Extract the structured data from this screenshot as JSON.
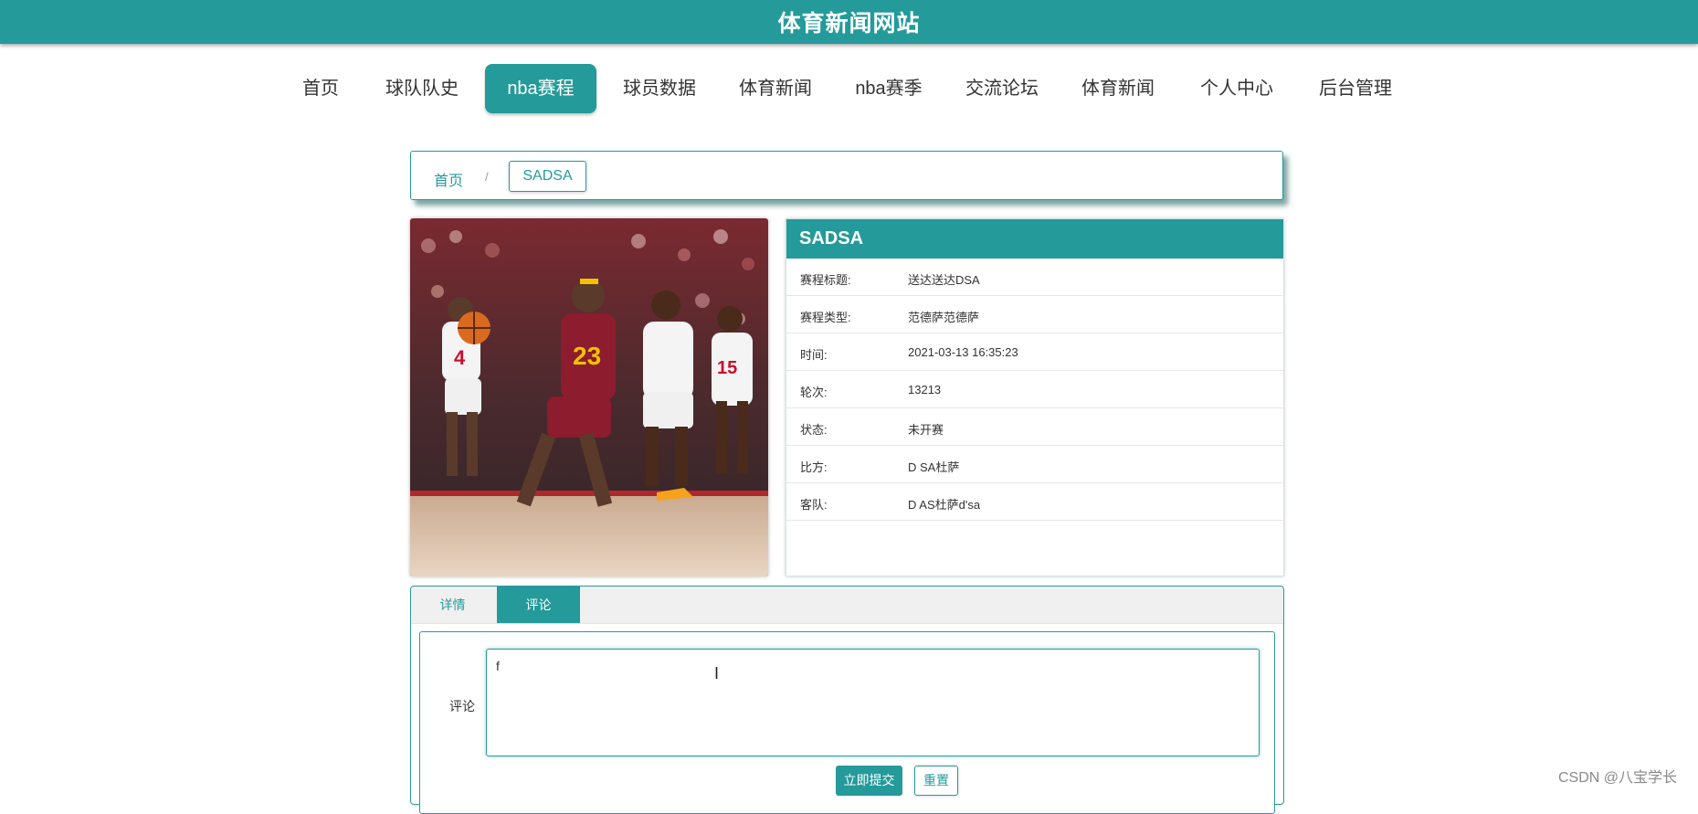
{
  "site": {
    "title": "体育新闻网站"
  },
  "nav": {
    "items": [
      {
        "label": "首页",
        "active": false
      },
      {
        "label": "球队队史",
        "active": false
      },
      {
        "label": "nba赛程",
        "active": true
      },
      {
        "label": "球员数据",
        "active": false
      },
      {
        "label": "体育新闻",
        "active": false
      },
      {
        "label": "nba赛季",
        "active": false
      },
      {
        "label": "交流论坛",
        "active": false
      },
      {
        "label": "体育新闻",
        "active": false
      },
      {
        "label": "个人中心",
        "active": false
      },
      {
        "label": "后台管理",
        "active": false
      }
    ]
  },
  "breadcrumb": {
    "home": "首页",
    "separator": "/",
    "current": "SADSA"
  },
  "detail": {
    "heading": "SADSA",
    "rows": [
      {
        "key": "赛程标题:",
        "value": "送达送达DSA"
      },
      {
        "key": "赛程类型:",
        "value": "范德萨范德萨"
      },
      {
        "key": "时间:",
        "value": "2021-03-13 16:35:23"
      },
      {
        "key": "轮次:",
        "value": "13213"
      },
      {
        "key": "状态:",
        "value": "未开赛"
      },
      {
        "key": "比方:",
        "value": "D SA杜萨"
      },
      {
        "key": "客队:",
        "value": "D AS杜萨d'sa"
      }
    ]
  },
  "tabs": {
    "details": "详情",
    "comments": "评论",
    "active": "comments"
  },
  "comment_form": {
    "label": "评论",
    "value": "f",
    "submit": "立即提交",
    "reset": "重置"
  },
  "watermark": "CSDN @八宝学长",
  "colors": {
    "primary": "#249a9a",
    "border": "#2a9a9a"
  },
  "photo": {
    "description_icon": "basketball-photo"
  }
}
